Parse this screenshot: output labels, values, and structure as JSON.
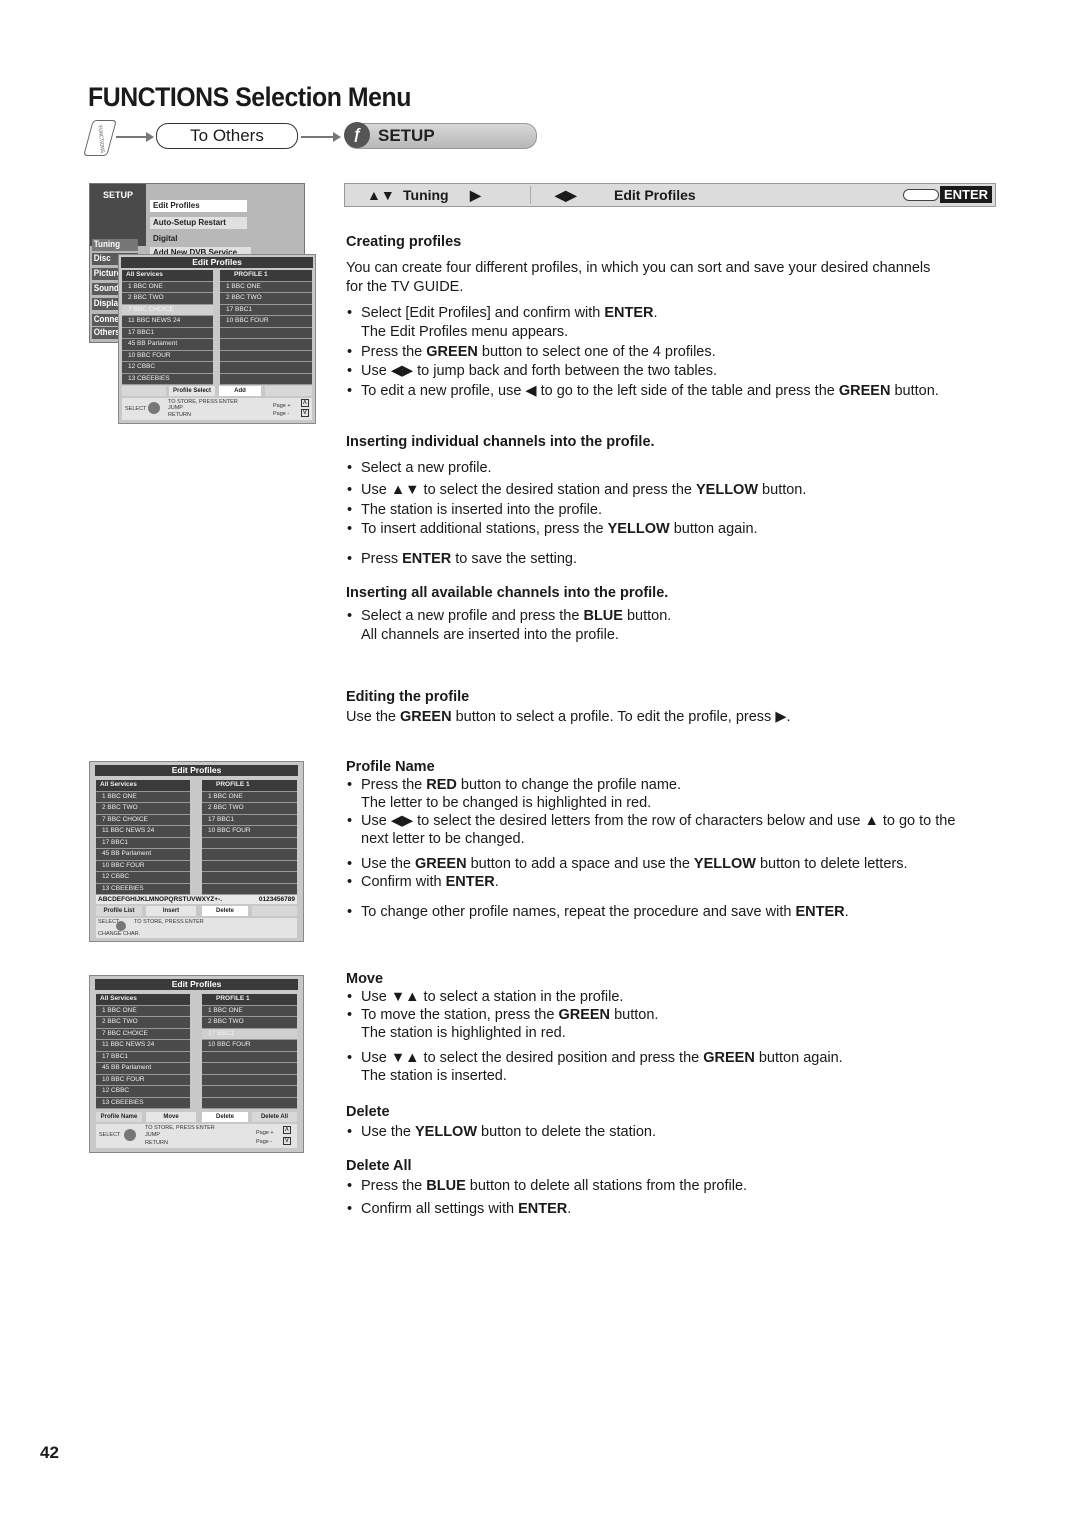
{
  "page": {
    "title": "FUNCTIONS Selection Menu",
    "page_number": "42"
  },
  "nav_path": {
    "start_icon": "functions-key-icon",
    "start_icon_label": "FUNCTIONS",
    "step1": "To Others",
    "step2_icon": "setup-wrench-icon",
    "step2": "SETUP"
  },
  "header_bar": {
    "up_down_symbol": "▲▼",
    "col1": "Tuning",
    "right_symbol": "▶",
    "left_right_symbol": "◀▶",
    "col2": "Edit Profiles",
    "hand_icon": "pointing-hand-icon",
    "enter": "ENTER"
  },
  "sections": {
    "creating": {
      "heading": "Creating profiles",
      "intro": "You can create four different profiles, in which you can sort and save your desired channels for the TV GUIDE.",
      "b1_pre": "Select [Edit Profiles] and confirm with ",
      "b1_bold": "ENTER",
      "b1_post": ".",
      "b1_line2": "The Edit Profiles menu appears.",
      "b2_pre": "Press the ",
      "b2_bold": "GREEN",
      "b2_post": " button to select one of the 4 profiles.",
      "b3": "Use ◀▶ to jump back and forth between the two tables.",
      "b4_pre": "To edit a new profile, use ◀ to go to the left side of the table and press the ",
      "b4_bold": "GREEN",
      "b4_post": " button."
    },
    "inserting_individual": {
      "heading": "Inserting individual channels into the profile.",
      "b1": "Select a new profile.",
      "b2_pre": "Use ▲▼ to select the desired station and press the ",
      "b2_bold": "YELLOW",
      "b2_post": " button.",
      "b3": "The station is inserted into the profile.",
      "b4_pre": "To insert additional stations, press the ",
      "b4_bold": "YELLOW",
      "b4_post": " button again.",
      "b5_pre": "Press ",
      "b5_bold": "ENTER",
      "b5_post": " to save the setting."
    },
    "inserting_all": {
      "heading": "Inserting all available channels into the profile.",
      "b1_pre": "Select a new profile and press the ",
      "b1_bold": "BLUE",
      "b1_post": " button.",
      "b1_line2": "All channels are inserted into the profile."
    },
    "editing": {
      "heading": "Editing the profile",
      "text_pre": "Use the ",
      "text_bold": "GREEN",
      "text_post": " button to select a profile. To edit the profile, press  ▶."
    },
    "profile_name": {
      "heading": "Profile Name",
      "b1_pre": "Press the ",
      "b1_bold": "RED",
      "b1_post": " button to change the profile name.",
      "b1_line2": "The letter to be changed is highlighted in red.",
      "b2": "Use ◀▶ to select the desired letters from the row of characters below and use ▲ to go to the next letter to be changed.",
      "b3_pre": "Use the ",
      "b3_bold1": "GREEN",
      "b3_mid": " button to add a space and use the ",
      "b3_bold2": "YELLOW",
      "b3_post": " button to delete letters.",
      "b4_pre": "Confirm with ",
      "b4_bold": "ENTER",
      "b4_post": ".",
      "b5_pre": "To change other profile names, repeat the procedure and save with ",
      "b5_bold": "ENTER",
      "b5_post": "."
    },
    "move": {
      "heading": "Move",
      "b1": "Use ▼▲ to select a station in the profile.",
      "b2_pre": "To move the station, press the ",
      "b2_bold": "GREEN",
      "b2_post": " button.",
      "b2_line2": "The station is highlighted in red.",
      "b3_pre": "Use ▼▲ to select the desired position and press the ",
      "b3_bold": "GREEN",
      "b3_post": " button again.",
      "b3_line2": "The station is inserted."
    },
    "delete": {
      "heading": "Delete",
      "b1_pre": "Use the ",
      "b1_bold": "YELLOW",
      "b1_post": " button to delete the station."
    },
    "delete_all": {
      "heading": "Delete All",
      "b1_pre": "Press the ",
      "b1_bold": "BLUE",
      "b1_post": " button to delete all stations from the profile.",
      "b2_pre": "Confirm all settings with ",
      "b2_bold": "ENTER",
      "b2_post": "."
    }
  },
  "screens": {
    "setup_menu": {
      "title": "SETUP",
      "side_items": [
        "Tuning",
        "Disc",
        "Picture",
        "Sound",
        "Display",
        "Connection",
        "Others"
      ],
      "menu_items": [
        "Edit Profiles",
        "Auto-Setup Restart",
        "Digital",
        "Add New DVB Service"
      ]
    },
    "edit_profiles_1": {
      "title": "Edit Profiles",
      "left_header": "All Services",
      "left_rows": [
        "1 BBC ONE",
        "2 BBC TWO",
        "7 BBC CHOICE",
        "11 BBC NEWS 24",
        "17 BBC1",
        "45 BB Parlament",
        "10 BBC FOUR",
        "12 CBBC",
        "13 CBEEBIES"
      ],
      "left_highlight": "7 BBC CHOICE",
      "right_header": "PROFILE 1",
      "right_rows": [
        "1 BBC ONE",
        "2 BBC TWO",
        "17 BBC1",
        "10 BBC FOUR",
        "",
        "",
        "",
        "",
        ""
      ],
      "buttons": [
        "",
        "Profile Select",
        "Add",
        ""
      ],
      "footer": {
        "select": "SELECT",
        "store": "TO STORE, PRESS ENTER",
        "jump": "JUMP",
        "return": "RETURN",
        "page_plus": "Page  +",
        "page_minus": "Page  -",
        "up_key": "Λ",
        "down_key": "V"
      }
    },
    "edit_profiles_2": {
      "title": "Edit Profiles",
      "left_header": "All Services",
      "left_rows": [
        "1 BBC ONE",
        "2 BBC TWO",
        "7 BBC CHOICE",
        "11 BBC NEWS 24",
        "17 BBC1",
        "45 BB Parlament",
        "10 BBC FOUR",
        "12 CBBC",
        "13 CBEEBIES"
      ],
      "right_header": "PROFILE 1",
      "right_rows": [
        "1 BBC ONE",
        "2 BBC TWO",
        "17 BBC1",
        "10 BBC FOUR",
        "",
        "",
        "",
        "",
        ""
      ],
      "char_row_letters": "ABCDEFGHIJKLMNOPQRSTUVWXYZ+-.",
      "char_row_digits": "0123456789",
      "buttons": [
        "Profile List",
        "Insert",
        "Delete",
        ""
      ],
      "footer": {
        "select": "SELECT",
        "store": "TO STORE, PRESS ENTER",
        "change": "CHANGE CHAR."
      }
    },
    "edit_profiles_3": {
      "title": "Edit Profiles",
      "left_header": "All Services",
      "left_rows": [
        "1 BBC ONE",
        "2 BBC TWO",
        "7 BBC CHOICE",
        "11 BBC NEWS 24",
        "17 BBC1",
        "45 BB Parlament",
        "10 BBC FOUR",
        "12 CBBC",
        "13 CBEEBIES"
      ],
      "right_header": "PROFILE 1",
      "right_rows": [
        "1 BBC ONE",
        "2 BBC TWO",
        "17 BBC1",
        "10 BBC FOUR",
        "",
        "",
        "",
        "",
        ""
      ],
      "right_highlight": "17 BBC1",
      "buttons": [
        "Profile Name",
        "Move",
        "Delete",
        "Delete All"
      ],
      "footer": {
        "select": "SELECT",
        "store": "TO STORE, PRESS ENTER",
        "jump": "JUMP",
        "return": "RETURN",
        "page_plus": "Page  +",
        "page_minus": "Page  -",
        "up_key": "Λ",
        "down_key": "V"
      }
    }
  }
}
